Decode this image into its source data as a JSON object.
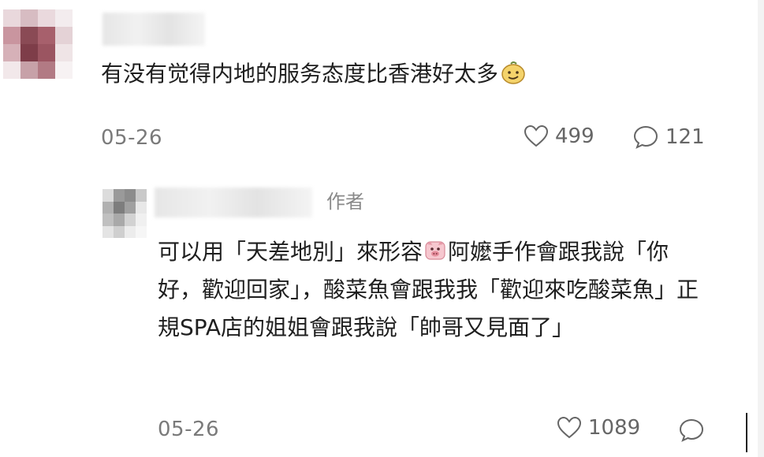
{
  "comments": [
    {
      "text": "有没有觉得内地的服务态度比香港好太多",
      "emoji": "smirking-face-emoji",
      "date": "05-26",
      "likes": "499",
      "replies": "121"
    }
  ],
  "reply": {
    "author_tag": "作者",
    "text_part1": "可以用「天差地別」來形容",
    "emoji": "pig-face-emoji",
    "text_part2": "阿嬤手作會跟我說「你好，歡迎回家」，酸菜魚會跟我我「歡迎來吃酸菜魚」正規SPA店的姐姐會跟我說「帥哥又見面了」",
    "date": "05-26",
    "likes": "1089"
  },
  "colors": {
    "text": "#1f1f1f",
    "meta": "#7a7a7a",
    "icon": "#666666",
    "avatar_main": "#8a4a55",
    "avatar_reply": "#9a9a9a"
  }
}
